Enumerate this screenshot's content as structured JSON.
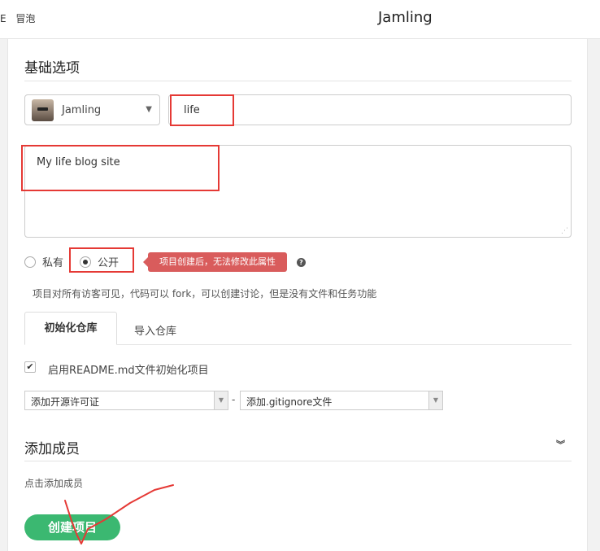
{
  "topbar": {
    "left_items": [
      "E",
      "冒泡"
    ],
    "user_name": "Jamling"
  },
  "basic": {
    "section_title": "基础选项",
    "owner_name": "Jamling",
    "project_name": "life",
    "description": "My life blog site",
    "visibility": {
      "private_label": "私有",
      "public_label": "公开",
      "selected": "公开"
    },
    "tooltip": "项目创建后，无法修改此属性",
    "help_icon": "?",
    "visibility_hint": "项目对所有访客可见，代码可以 fork，可以创建讨论，但是没有文件和任务功能"
  },
  "tabs": [
    {
      "label": "初始化仓库",
      "active": true
    },
    {
      "label": "导入仓库",
      "active": false
    }
  ],
  "init": {
    "readme_checked": true,
    "readme_label": "启用README.md文件初始化项目",
    "license_select": "添加开源许可证",
    "separator": "-",
    "gitignore_select": "添加.gitignore文件"
  },
  "members": {
    "section_title": "添加成员",
    "add_hint": "点击添加成员"
  },
  "create_button": "创建项目",
  "colors": {
    "accent": "#3bb871",
    "annotation": "#e53935",
    "tooltip_bg": "#d95c5c"
  },
  "icons": {
    "dropdown": "caret-down-icon",
    "expand": "double-chevron-down-icon",
    "help": "question-icon",
    "check": "check-icon"
  }
}
